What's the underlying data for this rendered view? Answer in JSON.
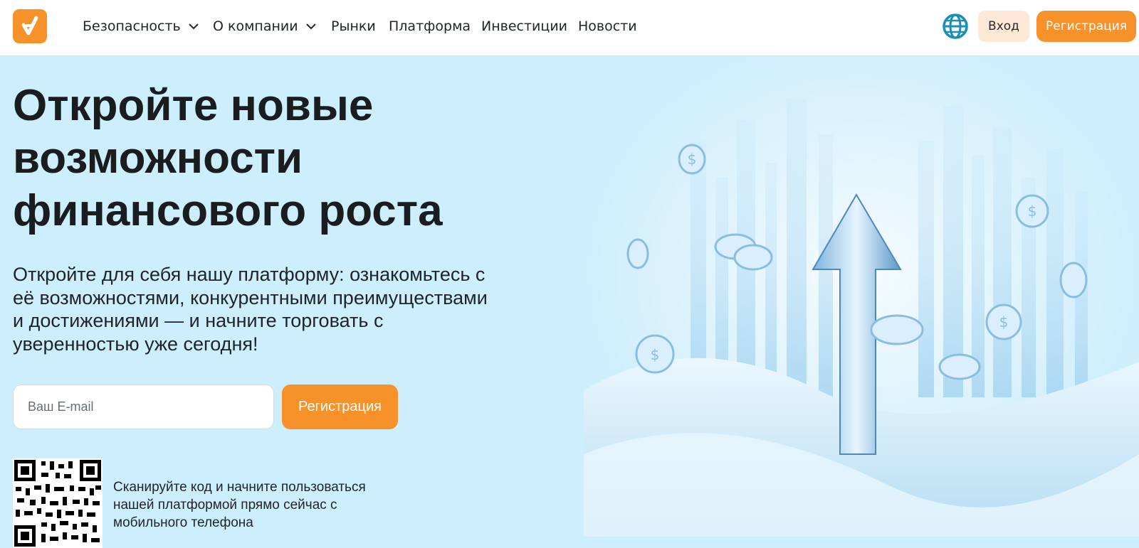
{
  "header": {
    "logo_name": "brand-logo",
    "nav": [
      {
        "label": "Безопасность",
        "has_dropdown": true
      },
      {
        "label": "О компании",
        "has_dropdown": true
      },
      {
        "label": "Рынки",
        "has_dropdown": false
      },
      {
        "label": "Платформа",
        "has_dropdown": false
      },
      {
        "label": "Инвестиции",
        "has_dropdown": false
      },
      {
        "label": "Новости",
        "has_dropdown": false
      }
    ],
    "language_icon": "globe-icon",
    "login_label": "Вход",
    "register_label": "Регистрация"
  },
  "hero": {
    "title_lines": [
      "Откройте новые",
      "возможности",
      "финансового роста"
    ],
    "description_lines": [
      "Откройте для себя нашу платформу: ознакомьтесь с",
      "её возможностями, конкурентными преимуществами",
      "и достижениями — и начните торговать с",
      "уверенностью уже сегодня!"
    ],
    "email_placeholder": "Ваш E-mail",
    "register_button": "Регистрация",
    "qr_text_lines": [
      "Сканируйте код и начните пользоваться",
      "нашей платформой прямо сейчас с",
      "мобильного телефона"
    ]
  },
  "colors": {
    "accent": "#f7922a",
    "login_bg": "#fde9d6",
    "hero_bg": "#cdeefc",
    "globe": "#1a8fb5",
    "text": "#1a1d20"
  }
}
